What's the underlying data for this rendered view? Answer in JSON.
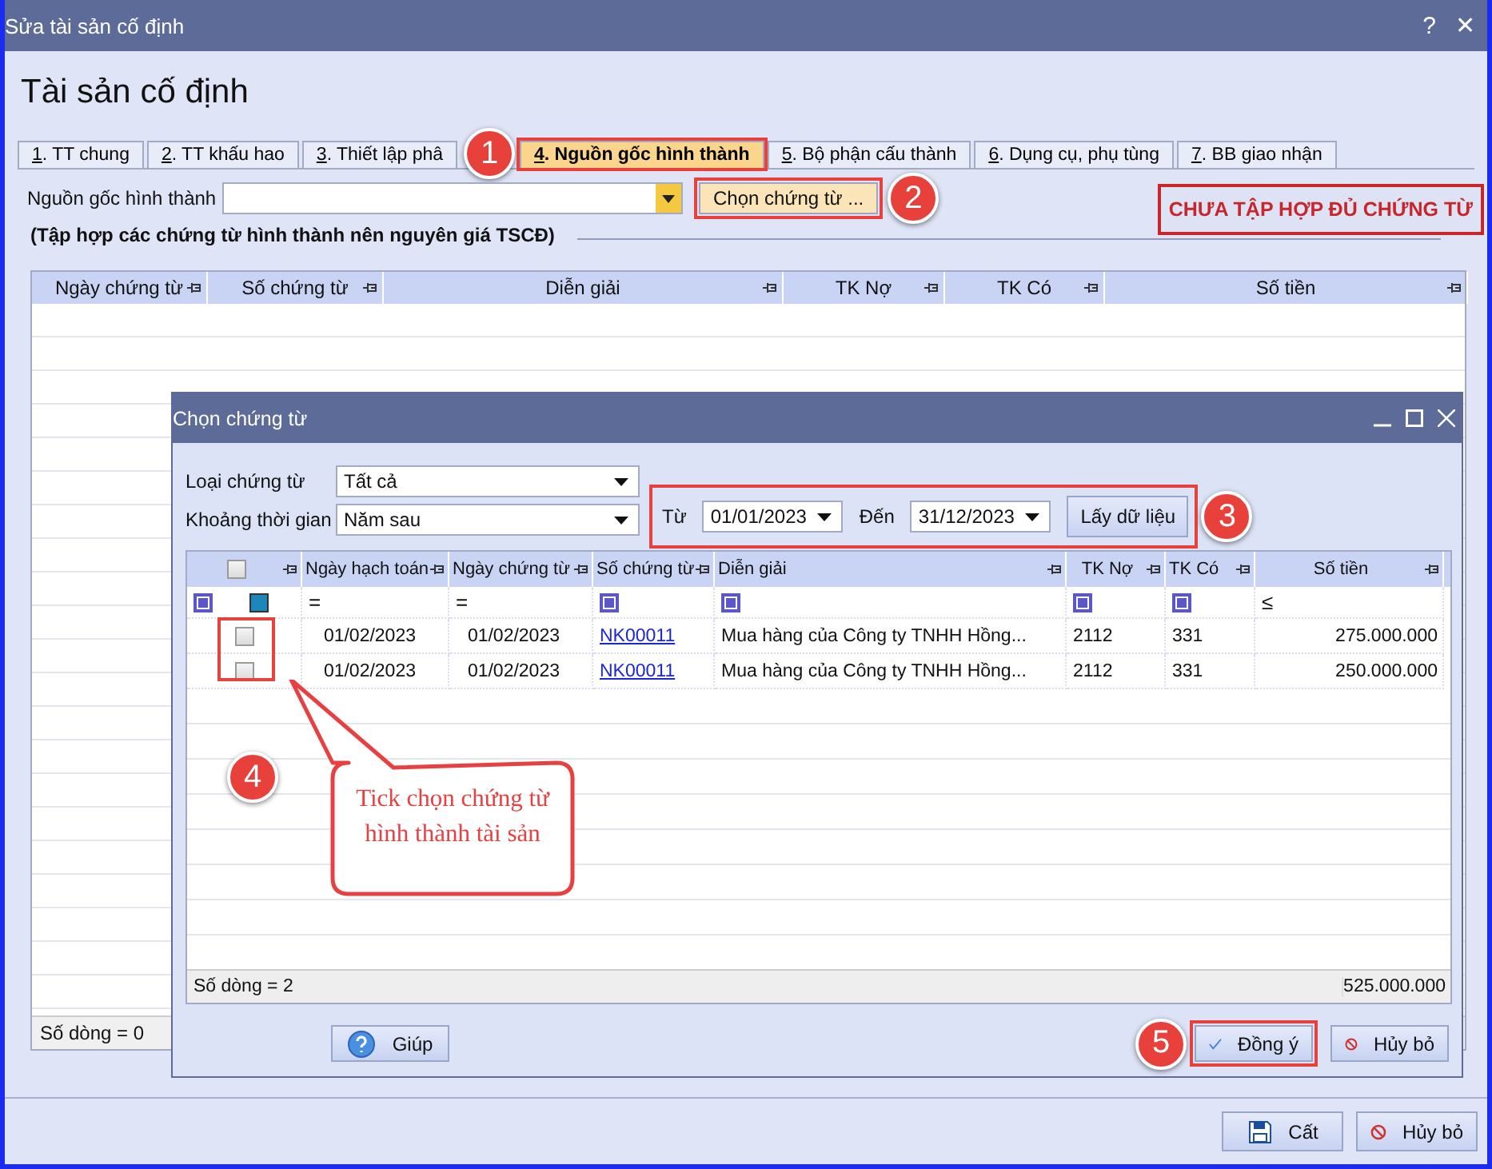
{
  "window": {
    "title": "Sửa tài sản cố định",
    "help": "?",
    "close": "✕"
  },
  "heading": "Tài sản cố định",
  "tabs": [
    {
      "number": "1",
      "label": ". TT chung",
      "selected": false
    },
    {
      "number": "2",
      "label": ". TT khấu hao",
      "selected": false
    },
    {
      "number": "3",
      "label": ". Thiết lập phâ",
      "selected": false
    },
    {
      "number": "4",
      "label": ". Nguồn gốc hình thành",
      "selected": true,
      "highlighted": true,
      "marker": "1"
    },
    {
      "number": "5",
      "label": ". Bộ phận cấu thành",
      "selected": false
    },
    {
      "number": "6",
      "label": ". Dụng cụ, phụ tùng",
      "selected": false
    },
    {
      "number": "7",
      "label": ". BB giao nhận",
      "selected": false
    }
  ],
  "source": {
    "label": "Nguồn gốc hình thành",
    "button": {
      "label": "Chọn chứng từ ...",
      "highlighted": true,
      "marker": "2"
    }
  },
  "status_badge": "CHƯA TẬP HỢP ĐỦ CHỨNG TỪ",
  "section_title": "(Tập hợp các chứng từ hình thành nên nguyên giá TSCĐ)",
  "grid": {
    "columns": [
      "Ngày chứng từ",
      "Số chứng từ",
      "Diễn giải",
      "TK Nợ",
      "TK Có",
      "Số tiền"
    ],
    "footer": "Số dòng = 0"
  },
  "dialog": {
    "title": "Chọn chứng từ",
    "fields": [
      {
        "label": "Loại chứng từ",
        "value": "Tất cả"
      },
      {
        "label": "Khoảng thời gian",
        "value": "Năm sau"
      }
    ],
    "date_range": {
      "from_label": "Từ",
      "from": "01/01/2023",
      "to_label": "Đến",
      "to": "31/12/2023",
      "button": "Lấy dữ liệu",
      "highlighted": true,
      "marker": "3"
    },
    "table": {
      "header_checked": false,
      "checkbox_highlighted": true,
      "columns": [
        {
          "title": "Ngày hạch toán",
          "filter": "="
        },
        {
          "title": "Ngày chứng từ",
          "filter": "="
        },
        {
          "title": "Số chứng từ"
        },
        {
          "title": "Diễn giải"
        },
        {
          "title": "TK Nợ"
        },
        {
          "title": "TK Có"
        },
        {
          "title": "Số tiền",
          "filter": "≤"
        }
      ],
      "rows": [
        {
          "checked": false,
          "cells": [
            "01/02/2023",
            "01/02/2023",
            "NK00011",
            "Mua hàng của Công ty TNHH Hồng...",
            "2112",
            "331",
            "275.000.000"
          ]
        },
        {
          "checked": false,
          "cells": [
            "01/02/2023",
            "01/02/2023",
            "NK00011",
            "Mua hàng của Công ty TNHH Hồng...",
            "2112",
            "331",
            "250.000.000"
          ]
        }
      ],
      "footer_count": "Số dòng = 2",
      "footer_total": "525.000.000"
    },
    "callout": {
      "marker": "4",
      "text": "Tick chọn chứng từ hình thành tài sản"
    },
    "buttons": [
      {
        "kind": "help",
        "label": "Giúp"
      },
      {
        "kind": "ok",
        "label": "Đồng ý",
        "highlighted": true,
        "marker": "5"
      },
      {
        "kind": "cancel",
        "label": "Hủy bỏ"
      }
    ]
  },
  "footer_buttons": [
    {
      "kind": "save",
      "label": "Cất"
    },
    {
      "kind": "cancel",
      "label": "Hủy bỏ"
    }
  ]
}
